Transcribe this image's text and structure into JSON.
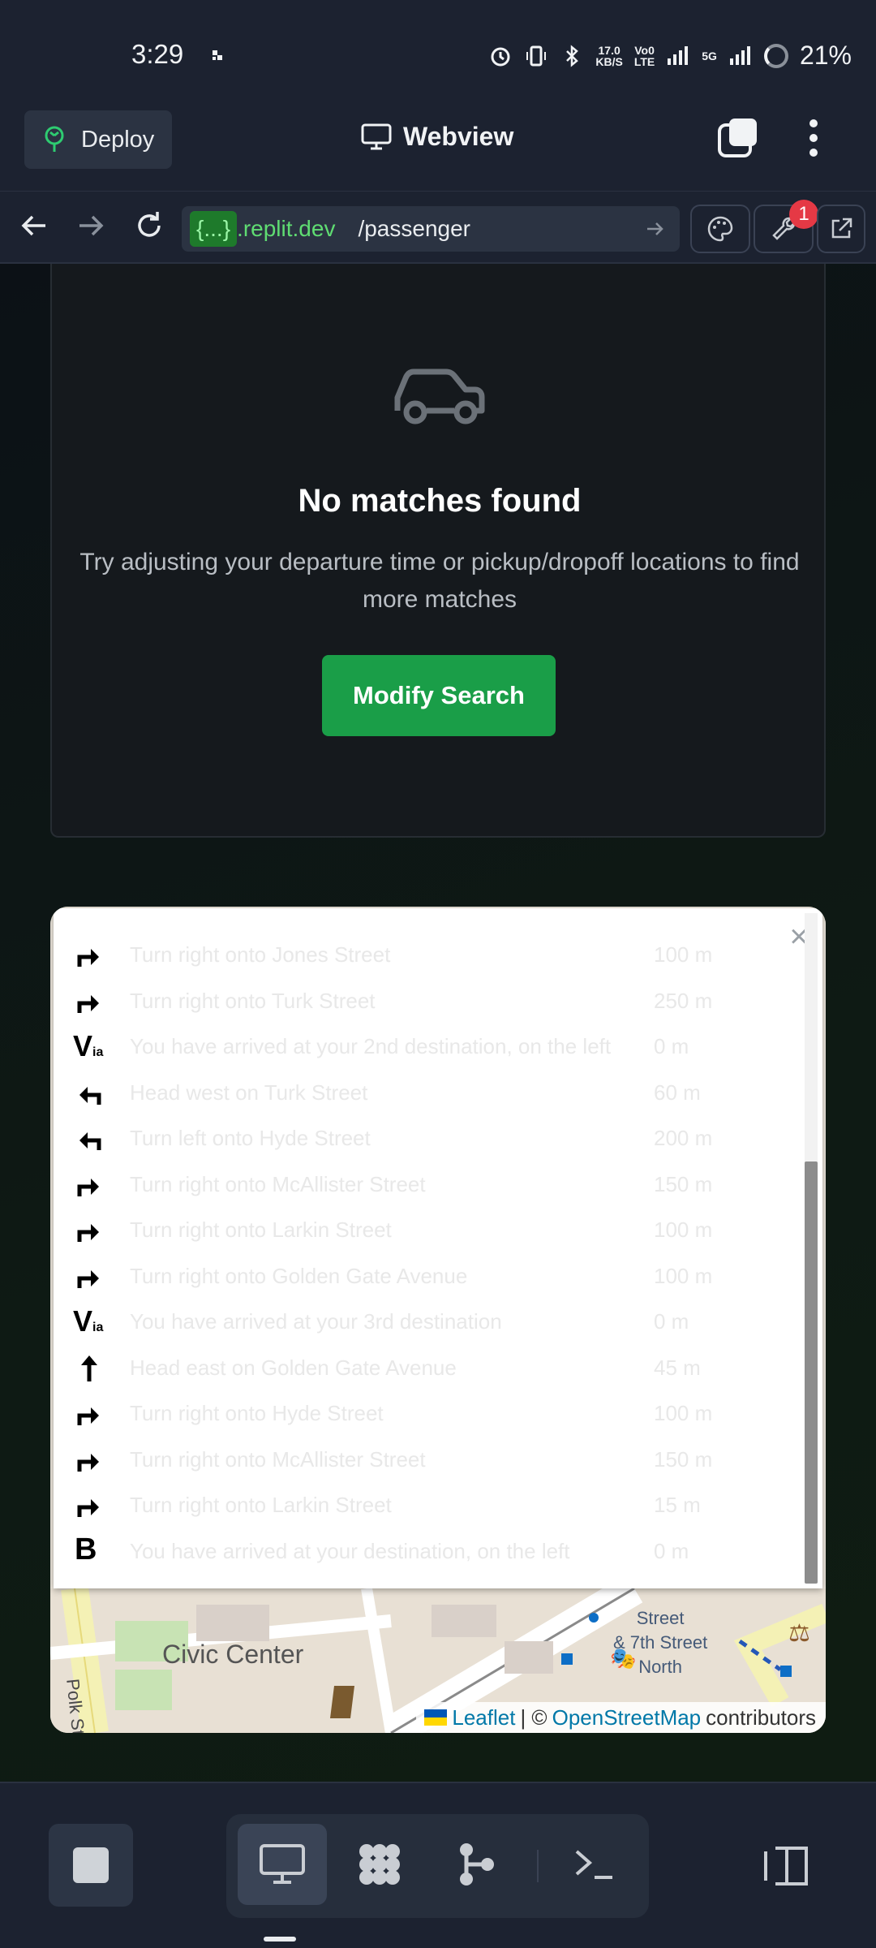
{
  "status_bar": {
    "time": "3:29",
    "net_speed_value": "17.0",
    "net_speed_unit": "KB/S",
    "volte_line1": "Vo0",
    "volte_line2": "LTE",
    "network": "5G",
    "battery": "21%"
  },
  "app_bar": {
    "deploy_label": "Deploy",
    "title": "Webview"
  },
  "url_bar": {
    "host_badge": "{...}",
    "host": ".replit.dev",
    "path": "/passenger",
    "notification_count": "1"
  },
  "empty_state": {
    "title": "No matches found",
    "subtitle": "Try adjusting your departure time or pickup/dropoff locations to find more matches",
    "button_label": "Modify Search"
  },
  "directions": {
    "close_symbol": "×",
    "steps": [
      {
        "icon": "turn-right",
        "text": "Turn right onto Jones Street",
        "distance": "100 m"
      },
      {
        "icon": "turn-right",
        "text": "Turn right onto Turk Street",
        "distance": "250 m"
      },
      {
        "icon": "via",
        "text": "You have arrived at your 2nd destination, on the left",
        "distance": "0 m"
      },
      {
        "icon": "turn-left",
        "text": "Head west on Turk Street",
        "distance": "60 m"
      },
      {
        "icon": "turn-left",
        "text": "Turn left onto Hyde Street",
        "distance": "200 m"
      },
      {
        "icon": "turn-right",
        "text": "Turn right onto McAllister Street",
        "distance": "150 m"
      },
      {
        "icon": "turn-right",
        "text": "Turn right onto Larkin Street",
        "distance": "100 m"
      },
      {
        "icon": "turn-right",
        "text": "Turn right onto Golden Gate Avenue",
        "distance": "100 m"
      },
      {
        "icon": "via",
        "text": "You have arrived at your 3rd destination",
        "distance": "0 m"
      },
      {
        "icon": "straight",
        "text": "Head east on Golden Gate Avenue",
        "distance": "45 m"
      },
      {
        "icon": "turn-right",
        "text": "Turn right onto Hyde Street",
        "distance": "100 m"
      },
      {
        "icon": "turn-right",
        "text": "Turn right onto McAllister Street",
        "distance": "150 m"
      },
      {
        "icon": "turn-right",
        "text": "Turn right onto Larkin Street",
        "distance": "15 m"
      },
      {
        "icon": "destination-b",
        "text": "You have arrived at your destination, on the left",
        "distance": "0 m"
      }
    ],
    "via_main": "V",
    "via_sub": "ia",
    "dest_letter": "B"
  },
  "map": {
    "label_civic_center": "Civic Center",
    "label_street_line1": "Street",
    "label_street_line2": "& 7th Street",
    "label_street_line3": "North",
    "label_polk": "Polk Stre",
    "attribution_leaflet": "Leaflet",
    "attribution_sep": "| ©",
    "attribution_osm": "OpenStreetMap",
    "attribution_suffix": "contributors"
  },
  "colors": {
    "primary_button": "#1a9e48",
    "chrome_background": "#1c2230",
    "badge": "#e53945"
  }
}
